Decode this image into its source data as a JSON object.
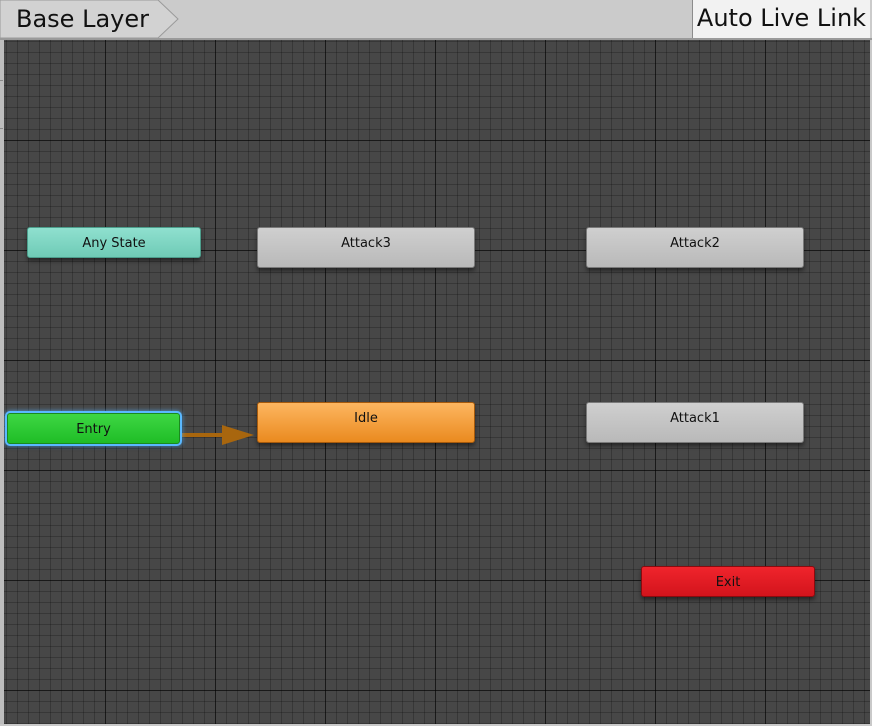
{
  "toolbar": {
    "breadcrumb_label": "Base Layer",
    "live_link_label": "Auto Live Link"
  },
  "graph": {
    "states": {
      "any_state": "Any State",
      "attack3": "Attack3",
      "attack2": "Attack2",
      "entry": "Entry",
      "idle": "Idle",
      "attack1": "Attack1",
      "exit": "Exit"
    },
    "colors": {
      "default_state": "#ea8a1f",
      "normal_state": "#bdbdbd",
      "any_state": "#7bd3bf",
      "entry": "#22c22a",
      "exit": "#d8151d",
      "transition": "#a8660e",
      "selection": "#5ab8ff"
    }
  }
}
